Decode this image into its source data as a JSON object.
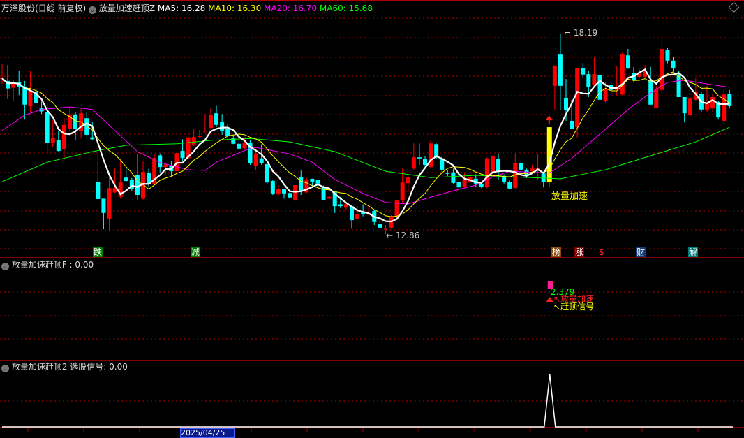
{
  "header": {
    "stock": "万泽股份(日线 前复权)",
    "indicator": "放量加速赶顶Z",
    "ma5": "MA5: 16.28",
    "ma10": "MA10: 16.30",
    "ma20": "MA20: 16.70",
    "ma60": "MA60: 15.68"
  },
  "colors": {
    "up": "#ff0000",
    "down": "#00ffff",
    "ma5": "#ffffff",
    "ma10": "#ffff00",
    "ma20": "#ff00ff",
    "ma60": "#00ff00",
    "grid": "#b00000",
    "signal_bar": "#ffff00"
  },
  "main": {
    "high_label": "18.19",
    "low_label": "12.86",
    "signal_label": "放量加速",
    "markers": [
      {
        "text": "跌",
        "bg": "#007a00",
        "color": "#ffffff"
      },
      {
        "text": "减",
        "bg": "#007a00",
        "color": "#ffffff"
      },
      {
        "text": "榜",
        "bg": "#8a4a10",
        "color": "#ffffff"
      },
      {
        "text": "涨",
        "bg": "#7a0000",
        "color": "#ffffff"
      },
      {
        "text": "$",
        "bg": "transparent",
        "color": "#ff2020"
      },
      {
        "text": "财",
        "bg": "#103a7a",
        "color": "#ffffff"
      },
      {
        "text": "解",
        "bg": "#007a7a",
        "color": "#ffffff"
      }
    ]
  },
  "panel1": {
    "title": "放量加速赶顶F : 0.00",
    "value_label": "2.379",
    "label_accel": "放量加速",
    "label_top": "赶顶信号"
  },
  "panel2": {
    "title": "放量加速赶顶2 选股信号: 0.00"
  },
  "axis": {
    "date_label": "2025/04/25"
  },
  "chart_data": {
    "type": "candlestick",
    "ohlc": [
      [
        17.0,
        17.38,
        16.85,
        17.0
      ],
      [
        16.93,
        17.35,
        16.45,
        16.73
      ],
      [
        16.75,
        16.95,
        16.4,
        16.9
      ],
      [
        16.9,
        17.2,
        16.55,
        16.78
      ],
      [
        16.78,
        16.93,
        15.9,
        16.3
      ],
      [
        16.26,
        17.19,
        16.11,
        16.67
      ],
      [
        16.63,
        17.1,
        16.3,
        16.35
      ],
      [
        16.2,
        16.38,
        16.05,
        16.12
      ],
      [
        16.11,
        16.33,
        15.0,
        15.28
      ],
      [
        15.29,
        15.89,
        15.18,
        15.42
      ],
      [
        15.35,
        15.6,
        15.05,
        15.07
      ],
      [
        15.12,
        15.94,
        14.85,
        15.76
      ],
      [
        15.65,
        16.2,
        15.6,
        16.04
      ],
      [
        16.04,
        16.1,
        15.35,
        15.65
      ],
      [
        15.6,
        16.2,
        15.4,
        16.07
      ],
      [
        15.94,
        16.1,
        15.45,
        15.5
      ],
      [
        15.43,
        15.83,
        15.36,
        15.38
      ],
      [
        14.25,
        14.98,
        13.75,
        13.79
      ],
      [
        13.8,
        13.8,
        12.99,
        13.42
      ],
      [
        13.27,
        14.4,
        12.94,
        14.08
      ],
      [
        13.97,
        14.6,
        13.95,
        14.08
      ],
      [
        13.85,
        14.81,
        13.8,
        14.23
      ],
      [
        14.36,
        14.6,
        14.25,
        14.27
      ],
      [
        14.29,
        14.35,
        14.0,
        14.07
      ],
      [
        14.42,
        14.98,
        13.75,
        13.9
      ],
      [
        13.8,
        14.79,
        13.75,
        14.51
      ],
      [
        14.49,
        14.6,
        14.1,
        14.2
      ],
      [
        14.2,
        14.98,
        14.15,
        14.88
      ],
      [
        14.95,
        15.0,
        14.5,
        14.64
      ],
      [
        14.64,
        14.75,
        14.45,
        14.71
      ],
      [
        14.68,
        14.81,
        14.4,
        14.53
      ],
      [
        14.53,
        15.2,
        14.5,
        15.01
      ],
      [
        15.07,
        15.38,
        14.8,
        14.88
      ],
      [
        14.88,
        15.6,
        14.6,
        15.43
      ],
      [
        15.24,
        15.66,
        15.2,
        15.44
      ],
      [
        15.45,
        15.63,
        15.4,
        15.46
      ],
      [
        15.59,
        16.05,
        15.56,
        15.6
      ],
      [
        15.68,
        16.2,
        15.66,
        16.02
      ],
      [
        16.07,
        16.27,
        15.7,
        15.76
      ],
      [
        15.85,
        16.05,
        15.5,
        15.61
      ],
      [
        15.66,
        15.8,
        15.35,
        15.46
      ],
      [
        15.4,
        15.5,
        15.25,
        15.26
      ],
      [
        15.26,
        15.35,
        15.1,
        15.13
      ],
      [
        15.14,
        15.4,
        15.1,
        15.27
      ],
      [
        15.29,
        15.35,
        14.7,
        14.75
      ],
      [
        14.68,
        15.07,
        14.55,
        15.0
      ],
      [
        14.87,
        15.25,
        14.7,
        14.75
      ],
      [
        14.72,
        14.72,
        14.2,
        14.23
      ],
      [
        14.27,
        14.31,
        13.9,
        13.94
      ],
      [
        13.92,
        14.15,
        13.88,
        14.05
      ],
      [
        14.05,
        14.05,
        13.8,
        13.94
      ],
      [
        13.95,
        13.97,
        13.8,
        13.83
      ],
      [
        13.75,
        14.16,
        13.75,
        14.16
      ],
      [
        14.38,
        14.55,
        13.9,
        14.0
      ],
      [
        13.97,
        14.35,
        13.95,
        14.31
      ],
      [
        14.33,
        14.33,
        14.15,
        14.25
      ],
      [
        14.29,
        14.33,
        14.0,
        14.2
      ],
      [
        14.12,
        14.15,
        13.75,
        13.77
      ],
      [
        13.8,
        14.05,
        13.75,
        13.85
      ],
      [
        13.97,
        14.0,
        13.42,
        13.6
      ],
      [
        13.65,
        13.85,
        13.55,
        13.6
      ],
      [
        13.56,
        13.68,
        13.5,
        13.65
      ],
      [
        13.6,
        13.6,
        13.0,
        13.23
      ],
      [
        13.27,
        13.6,
        13.25,
        13.38
      ],
      [
        13.45,
        13.65,
        13.33,
        13.38
      ],
      [
        13.39,
        13.65,
        13.35,
        13.42
      ],
      [
        13.47,
        13.5,
        13.1,
        13.18
      ],
      [
        13.12,
        13.3,
        13.0,
        13.03
      ],
      [
        12.98,
        13.1,
        12.86,
        13.0
      ],
      [
        13.03,
        13.36,
        13.0,
        13.34
      ],
      [
        13.33,
        13.75,
        13.3,
        13.75
      ],
      [
        13.75,
        14.6,
        13.7,
        14.23
      ],
      [
        14.21,
        14.4,
        13.98,
        14.38
      ],
      [
        14.6,
        15.27,
        14.55,
        14.9
      ],
      [
        14.9,
        15.27,
        14.7,
        14.87
      ],
      [
        14.85,
        14.93,
        14.6,
        14.7
      ],
      [
        14.64,
        15.36,
        14.6,
        15.27
      ],
      [
        15.25,
        15.27,
        14.85,
        14.9
      ],
      [
        14.87,
        14.93,
        14.45,
        14.57
      ],
      [
        14.48,
        14.55,
        14.4,
        14.47
      ],
      [
        14.5,
        14.6,
        14.2,
        14.22
      ],
      [
        14.25,
        14.45,
        14.05,
        14.1
      ],
      [
        14.12,
        14.5,
        14.1,
        14.3
      ],
      [
        14.25,
        14.55,
        14.2,
        14.38
      ],
      [
        14.33,
        14.45,
        14.1,
        14.2
      ],
      [
        14.2,
        14.25,
        14.08,
        14.12
      ],
      [
        14.12,
        14.9,
        14.08,
        14.87
      ],
      [
        14.5,
        14.95,
        14.45,
        14.93
      ],
      [
        14.85,
        15.0,
        14.3,
        14.53
      ],
      [
        14.4,
        14.45,
        14.2,
        14.25
      ],
      [
        14.25,
        14.28,
        14.05,
        14.07
      ],
      [
        14.09,
        15.0,
        14.05,
        14.74
      ],
      [
        14.74,
        14.78,
        14.52,
        14.57
      ],
      [
        14.57,
        14.6,
        14.35,
        14.4
      ],
      [
        14.53,
        14.7,
        14.5,
        14.6
      ],
      [
        14.55,
        15.0,
        14.3,
        14.6
      ],
      [
        14.47,
        14.5,
        14.1,
        14.25
      ],
      [
        14.25,
        15.7,
        14.12,
        15.7
      ],
      [
        16.8,
        17.34,
        16.17,
        17.34
      ],
      [
        17.63,
        18.19,
        16.17,
        16.8
      ],
      [
        16.48,
        16.98,
        15.87,
        16.15
      ],
      [
        15.87,
        16.43,
        15.65,
        15.65
      ],
      [
        15.7,
        17.28,
        15.42,
        17.28
      ],
      [
        17.28,
        17.41,
        17.0,
        17.1
      ],
      [
        17.11,
        17.2,
        16.5,
        16.76
      ],
      [
        16.82,
        17.56,
        16.8,
        17.11
      ],
      [
        17.09,
        17.3,
        16.4,
        16.43
      ],
      [
        16.39,
        16.9,
        16.35,
        16.72
      ],
      [
        16.82,
        16.9,
        16.55,
        16.69
      ],
      [
        16.69,
        17.32,
        16.54,
        16.76
      ],
      [
        16.57,
        17.69,
        16.53,
        17.63
      ],
      [
        17.61,
        17.78,
        17.25,
        17.26
      ],
      [
        17.15,
        17.3,
        16.9,
        16.95
      ],
      [
        17.04,
        17.25,
        17.0,
        17.15
      ],
      [
        17.04,
        17.35,
        17.0,
        17.19
      ],
      [
        16.95,
        17.3,
        16.3,
        16.3
      ],
      [
        16.22,
        16.8,
        16.2,
        16.7
      ],
      [
        16.69,
        18.15,
        16.6,
        17.78
      ],
      [
        17.76,
        17.8,
        17.4,
        17.47
      ],
      [
        17.47,
        17.56,
        17.19,
        17.26
      ],
      [
        17.1,
        17.2,
        16.5,
        16.5
      ],
      [
        16.5,
        16.5,
        15.83,
        16.07
      ],
      [
        16.02,
        16.5,
        15.98,
        16.46
      ],
      [
        16.43,
        17.02,
        16.4,
        16.63
      ],
      [
        16.59,
        16.63,
        16.1,
        16.17
      ],
      [
        16.17,
        16.8,
        16.1,
        16.35
      ],
      [
        16.2,
        16.6,
        16.1,
        16.5
      ],
      [
        16.37,
        16.4,
        15.9,
        15.96
      ],
      [
        15.87,
        16.7,
        15.8,
        16.57
      ],
      [
        16.59,
        16.69,
        16.2,
        16.26
      ]
    ],
    "signal_index": 97,
    "ma20_points": [
      [
        0,
        15.61
      ],
      [
        4,
        16.02
      ],
      [
        7,
        16.17
      ],
      [
        12,
        16.24
      ],
      [
        16,
        16.17
      ],
      [
        20,
        15.61
      ],
      [
        24,
        15.05
      ],
      [
        28,
        14.76
      ],
      [
        33,
        14.57
      ],
      [
        36,
        14.55
      ],
      [
        38,
        14.77
      ],
      [
        44,
        15.14
      ],
      [
        45,
        15.16
      ],
      [
        51,
        14.99
      ],
      [
        55,
        14.77
      ],
      [
        59,
        14.31
      ],
      [
        64,
        13.94
      ],
      [
        68,
        13.7
      ],
      [
        72,
        13.66
      ],
      [
        76,
        13.84
      ],
      [
        80,
        14.01
      ],
      [
        84,
        14.16
      ],
      [
        87,
        14.38
      ],
      [
        90,
        14.53
      ],
      [
        97,
        14.48
      ],
      [
        101,
        14.87
      ],
      [
        106,
        15.52
      ],
      [
        111,
        16.17
      ],
      [
        115,
        16.61
      ],
      [
        118,
        16.89
      ],
      [
        121,
        16.95
      ],
      [
        125,
        16.85
      ],
      [
        129,
        16.76
      ]
    ],
    "ma60_points": [
      [
        0,
        14.25
      ],
      [
        8,
        14.77
      ],
      [
        16,
        15.05
      ],
      [
        22,
        15.22
      ],
      [
        31,
        15.26
      ],
      [
        37,
        15.35
      ],
      [
        44,
        15.4
      ],
      [
        51,
        15.31
      ],
      [
        59,
        15.05
      ],
      [
        68,
        14.53
      ],
      [
        76,
        14.36
      ],
      [
        84,
        14.42
      ],
      [
        94,
        14.36
      ],
      [
        99,
        14.33
      ],
      [
        107,
        14.57
      ],
      [
        115,
        14.94
      ],
      [
        123,
        15.31
      ],
      [
        129,
        15.7
      ]
    ],
    "high": 18.19,
    "low": 12.86,
    "panel1_value": 2.379,
    "panel2_signal": {
      "index": 97,
      "value": 1,
      "baseline": 0
    }
  }
}
